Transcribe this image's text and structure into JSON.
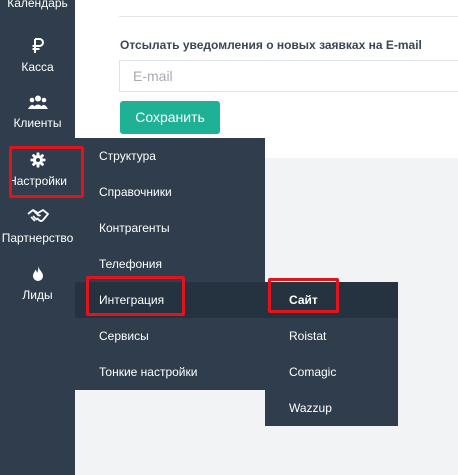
{
  "sidebar": {
    "items": [
      {
        "label": "Календарь",
        "icon": "calendar-icon"
      },
      {
        "label": "Касса",
        "icon": "ruble-icon"
      },
      {
        "label": "Клиенты",
        "icon": "users-icon"
      },
      {
        "label": "Настройки",
        "icon": "gear-icon"
      },
      {
        "label": "Партнерство",
        "icon": "handshake-icon"
      },
      {
        "label": "Лиды",
        "icon": "fire-icon"
      }
    ]
  },
  "form": {
    "email_label": "Отсылать уведомления о новых заявках на E-mail",
    "email_placeholder": "E-mail",
    "email_value": "",
    "save_label": "Сохранить"
  },
  "settings_menu": {
    "items": [
      {
        "label": "Структура"
      },
      {
        "label": "Справочники"
      },
      {
        "label": "Контрагенты"
      },
      {
        "label": "Телефония"
      },
      {
        "label": "Интеграция",
        "active": true
      },
      {
        "label": "Сервисы"
      },
      {
        "label": "Тонкие настройки"
      }
    ]
  },
  "integration_menu": {
    "items": [
      {
        "label": "Сайт",
        "active": true
      },
      {
        "label": "Roistat"
      },
      {
        "label": "Comagic"
      },
      {
        "label": "Wazzup"
      }
    ]
  },
  "colors": {
    "sidebar_bg": "#2f3d4c",
    "active_bg": "#253240",
    "accent": "#1fb196",
    "highlight": "#e3131b"
  }
}
